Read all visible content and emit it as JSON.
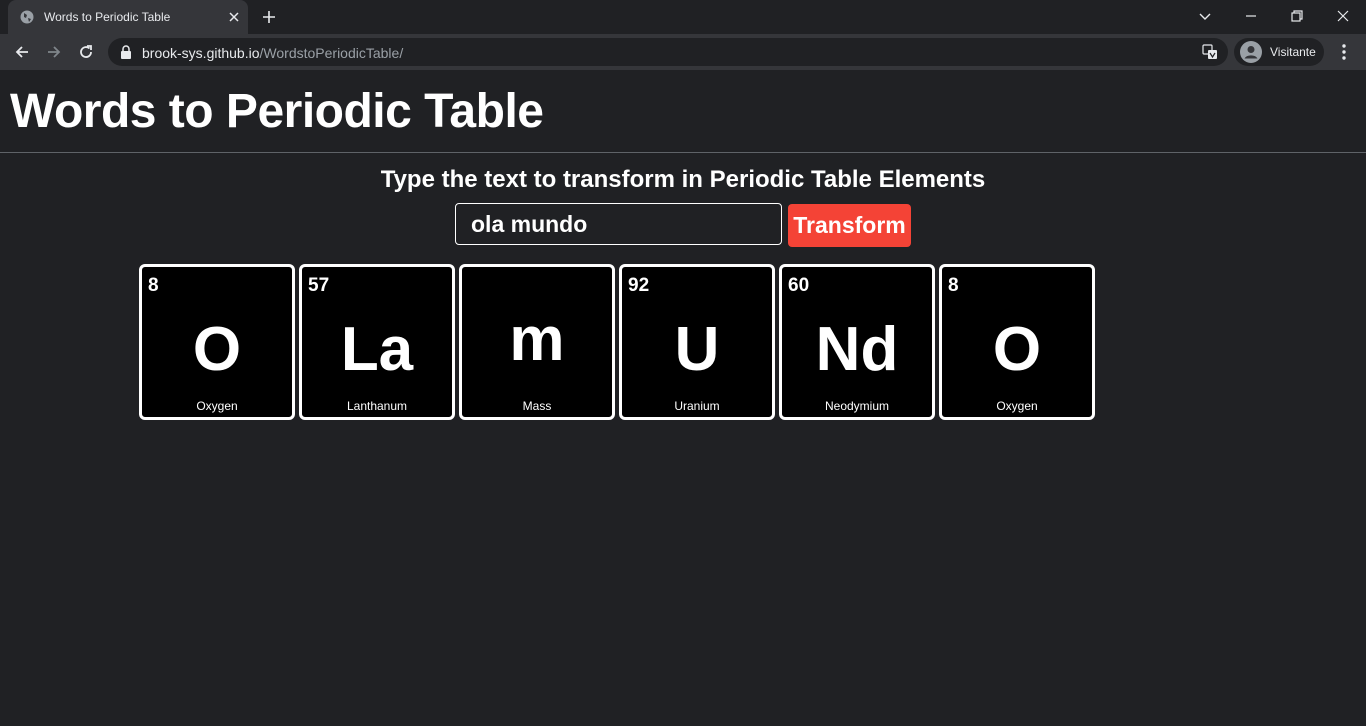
{
  "browser": {
    "tab_title": "Words to Periodic Table",
    "url_host": "brook-sys.github.io",
    "url_path": "/WordstoPeriodicTable/",
    "profile_name": "Visitante"
  },
  "page": {
    "title": "Words to Periodic Table",
    "subtitle": "Type the text to transform in Periodic Table Elements",
    "input_value": "ola mundo",
    "button_label": "Transform"
  },
  "tiles": [
    {
      "number": "8",
      "symbol": "O",
      "name": "Oxygen"
    },
    {
      "number": "57",
      "symbol": "La",
      "name": "Lanthanum"
    },
    {
      "number": "",
      "symbol": "m",
      "name": "Mass"
    },
    {
      "number": "92",
      "symbol": "U",
      "name": "Uranium"
    },
    {
      "number": "60",
      "symbol": "Nd",
      "name": "Neodymium"
    },
    {
      "number": "8",
      "symbol": "O",
      "name": "Oxygen"
    }
  ],
  "colors": {
    "background": "#202124",
    "accent_button": "#f44336",
    "tile_background": "#000000",
    "tile_border": "#ffffff"
  }
}
